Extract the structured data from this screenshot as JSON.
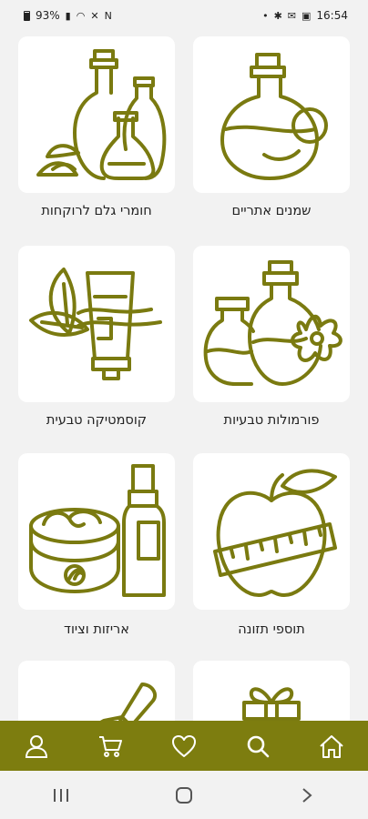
{
  "status_bar": {
    "battery": "93%",
    "time": "16:54"
  },
  "categories": [
    {
      "label": "שמנים אתריים",
      "icon": "essential-oil-flask-icon"
    },
    {
      "label": "חומרי גלם לרוקחות",
      "icon": "pharmacy-bottles-icon"
    },
    {
      "label": "פורמולות טבעיות",
      "icon": "natural-formula-bottles-icon"
    },
    {
      "label": "קוסמטיקה טבעית",
      "icon": "natural-cosmetics-tube-icon"
    },
    {
      "label": "תוספי תזונה",
      "icon": "apple-measuring-tape-icon"
    },
    {
      "label": "אריזות וציוד",
      "icon": "jar-and-bottle-icon"
    },
    {
      "label": "",
      "icon": "scoop-icon"
    },
    {
      "label": "",
      "icon": "gift-box-icon"
    }
  ],
  "bottom_nav": [
    {
      "name": "profile",
      "icon": "user-icon"
    },
    {
      "name": "cart",
      "icon": "cart-icon"
    },
    {
      "name": "favorites",
      "icon": "heart-icon"
    },
    {
      "name": "search",
      "icon": "search-icon"
    },
    {
      "name": "home",
      "icon": "home-icon"
    }
  ],
  "colors": {
    "accent": "#7d7d0f",
    "icon_stroke": "#7a7a10",
    "card_bg": "#ffffff",
    "page_bg": "#f2f2f2"
  }
}
